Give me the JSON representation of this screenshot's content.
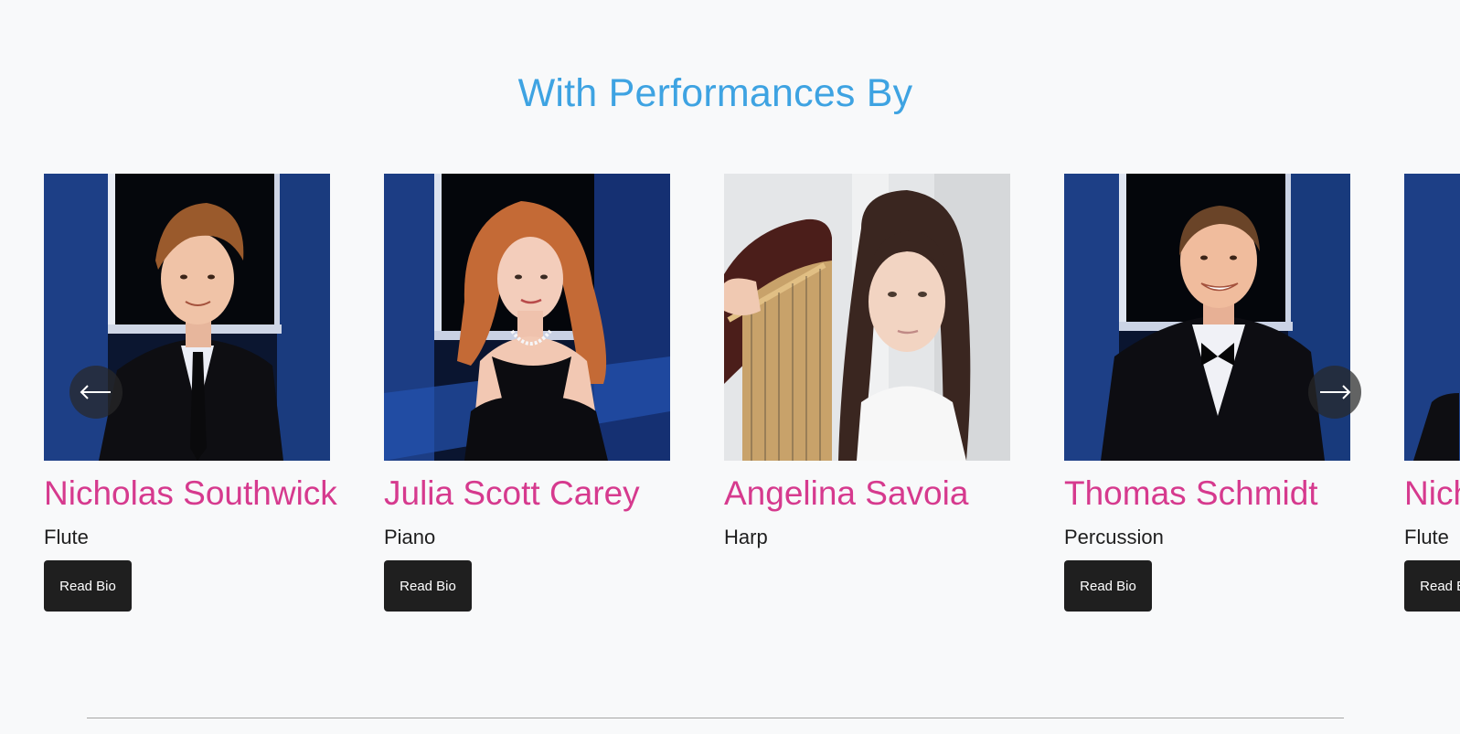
{
  "section": {
    "title": "With Performances By"
  },
  "performers": [
    {
      "name": "Nicholas Southwick",
      "instrument": "Flute",
      "button_label": "Read Bio"
    },
    {
      "name": "Julia Scott Carey",
      "instrument": "Piano",
      "button_label": "Read Bio"
    },
    {
      "name": "Angelina Savoia",
      "instrument": "Harp",
      "button_label": ""
    },
    {
      "name": "Thomas Schmidt",
      "instrument": "Percussion",
      "button_label": "Read Bio"
    },
    {
      "name": "Nicholas Southwick",
      "instrument": "Flute",
      "button_label": "Read Bio"
    }
  ],
  "controls": {
    "prev_icon": "arrow-left-icon",
    "next_icon": "arrow-right-icon"
  },
  "colors": {
    "title": "#3ea3e2",
    "name": "#d63a8e",
    "button_bg": "#1f1f1f",
    "page_bg": "#f8f9fa"
  }
}
